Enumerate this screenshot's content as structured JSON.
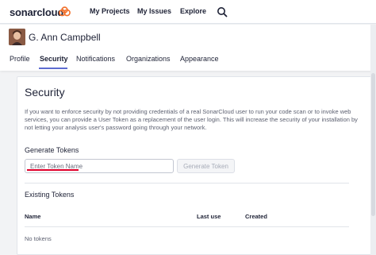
{
  "topbar": {
    "logo_text": "sonarcloud",
    "logo_icon": "sonarcloud-logo-icon",
    "nav": {
      "projects": "My Projects",
      "issues": "My Issues",
      "explore": "Explore"
    },
    "search_icon": "search-icon"
  },
  "user": {
    "name": "G. Ann Campbell"
  },
  "tabs": [
    {
      "label": "Profile",
      "active": false
    },
    {
      "label": "Security",
      "active": true
    },
    {
      "label": "Notifications",
      "active": false
    },
    {
      "label": "Organizations",
      "active": false
    },
    {
      "label": "Appearance",
      "active": false
    }
  ],
  "security": {
    "title": "Security",
    "description": "If you want to enforce security by not providing credentials of a real SonarCloud user to run your code scan or to invoke web services, you can provide a User Token as a replacement of the user login. This will increase the security of your installation by not letting your analysis user's password going through your network.",
    "generate_title": "Generate Tokens",
    "token_placeholder": "Enter Token Name",
    "generate_button": "Generate Token",
    "existing_title": "Existing Tokens",
    "columns": {
      "name": "Name",
      "last_use": "Last use",
      "created": "Created"
    },
    "empty_text": "No tokens"
  },
  "colors": {
    "accent": "#5d6cd0",
    "logo_orange": "#f3702a",
    "annotation_red": "#e0002a"
  }
}
